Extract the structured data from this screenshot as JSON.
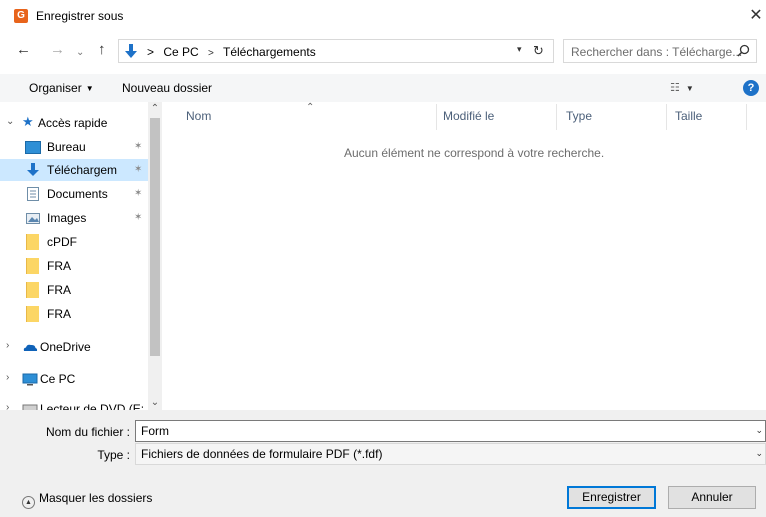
{
  "window": {
    "title": "Enregistrer sous",
    "app_icon_letter": "G"
  },
  "navigation": {
    "back": "←",
    "forward": "→",
    "history": "⌄",
    "up": "↑",
    "path": [
      "Ce PC",
      "Téléchargements"
    ],
    "separator": ">"
  },
  "search": {
    "placeholder": "Rechercher dans : Télécharge..."
  },
  "toolbar": {
    "organise_label": "Organiser",
    "new_folder_label": "Nouveau dossier",
    "help": "?"
  },
  "sidebar": {
    "quick_access": "Accès rapide",
    "items": [
      {
        "label": "Bureau",
        "icon": "desktop-icon",
        "pinned": true
      },
      {
        "label": "Téléchargem",
        "icon": "download-icon",
        "pinned": true,
        "selected": true
      },
      {
        "label": "Documents",
        "icon": "documents-icon",
        "pinned": true
      },
      {
        "label": "Images",
        "icon": "images-icon",
        "pinned": true
      },
      {
        "label": "cPDF",
        "icon": "folder-icon"
      },
      {
        "label": "FRA",
        "icon": "folder-icon"
      },
      {
        "label": "FRA",
        "icon": "folder-icon"
      },
      {
        "label": "FRA",
        "icon": "folder-icon"
      }
    ],
    "onedrive": "OneDrive",
    "this_pc": "Ce PC",
    "drive": "Lecteur de DVD (E:"
  },
  "columns": [
    "Nom",
    "Modifié le",
    "Type",
    "Taille"
  ],
  "empty_message": "Aucun élément ne correspond à votre recherche.",
  "fields": {
    "filename_label": "Nom du fichier :",
    "filename_value": "Form",
    "type_label": "Type :",
    "type_value": "Fichiers de données de formulaire PDF (*.fdf)"
  },
  "footer": {
    "hide_folders": "Masquer les dossiers",
    "save": "Enregistrer",
    "cancel": "Annuler"
  },
  "colors": {
    "accent": "#0078d7",
    "selected_bg": "#cce8ff",
    "folder": "#fcd665",
    "help": "#1e72c8",
    "app_icon": "#e8641b"
  }
}
